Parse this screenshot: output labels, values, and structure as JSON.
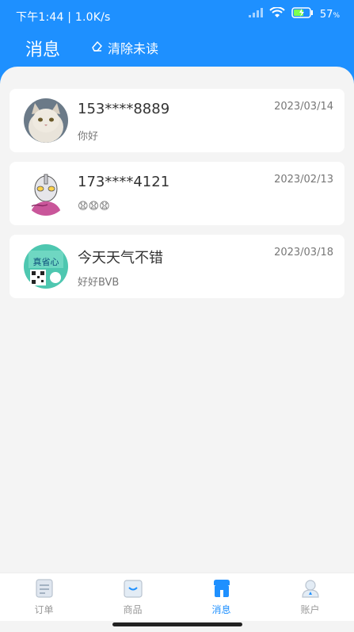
{
  "status_bar": {
    "time_speed": "下午1:44 | 1.0K/s",
    "battery_percent": "57"
  },
  "header": {
    "title": "消息",
    "clear_label": "清除未读"
  },
  "messages": [
    {
      "name": "153****8889",
      "preview": "你好",
      "date": "2023/03/14"
    },
    {
      "name": "173****4121",
      "preview": "😧😧😧",
      "date": "2023/02/13"
    },
    {
      "name": "今天天气不错",
      "preview": "好好BVB",
      "date": "2023/03/18"
    }
  ],
  "avatar_icons": [
    "cat-avatar",
    "ultraman-avatar",
    "qr-poster-avatar"
  ],
  "avatar3_text": "真省心",
  "tabs": [
    {
      "label": "订单",
      "icon": "order-list-icon",
      "active": false
    },
    {
      "label": "商品",
      "icon": "product-box-icon",
      "active": false
    },
    {
      "label": "消息",
      "icon": "message-shop-icon",
      "active": true
    },
    {
      "label": "账户",
      "icon": "account-user-icon",
      "active": false
    }
  ],
  "colors": {
    "accent": "#1e90ff",
    "background": "#f4f4f4",
    "card": "#ffffff"
  }
}
